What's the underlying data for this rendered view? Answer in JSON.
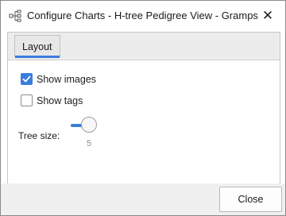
{
  "window": {
    "title": "Configure Charts - H-tree Pedigree View - Gramps",
    "close_glyph": "✕",
    "app_icon": "pedigree-chart-icon"
  },
  "tabs": [
    {
      "label": "Layout",
      "active": true
    }
  ],
  "options": {
    "show_images": {
      "label": "Show images",
      "checked": true
    },
    "show_tags": {
      "label": "Show tags",
      "checked": false
    }
  },
  "tree_size": {
    "label": "Tree size:",
    "value": "5",
    "slider_fraction": 0.45
  },
  "footer": {
    "close_label": "Close"
  },
  "colors": {
    "accent": "#3b7ddd",
    "tab_bg": "#ececec",
    "footer_bg": "#f0f0f0"
  }
}
